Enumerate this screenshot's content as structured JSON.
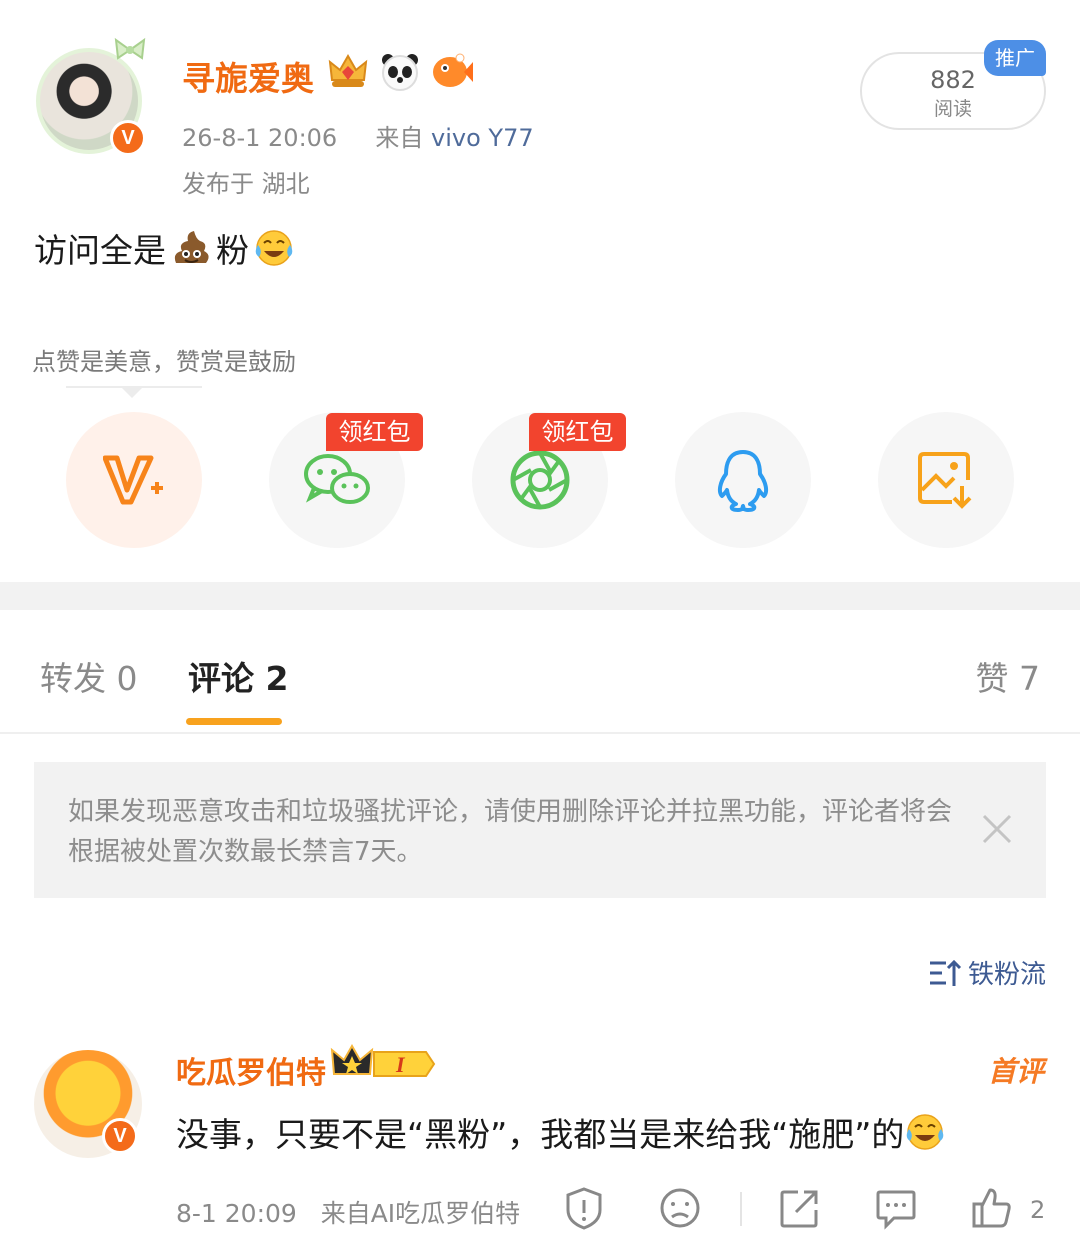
{
  "post": {
    "author": {
      "name": "寻旎爱奥",
      "badges": [
        "crown-gem-badge",
        "panda-badge",
        "orange-fish-badge"
      ],
      "verified": true
    },
    "time": "26-8-1 20:06",
    "source_prefix": "来自",
    "source": "vivo Y77",
    "location": "发布于 湖北",
    "read_count": "882",
    "read_label": "阅读",
    "promo_tag": "推广",
    "content_parts": [
      "访问全是",
      "粉"
    ],
    "content_emojis": [
      "poop-emoji",
      "laugh-cry-emoji"
    ]
  },
  "share": {
    "reward_tip": "点赞是美意，赞赏是鼓励",
    "redpack_label": "领红包",
    "buttons": [
      "vplus-icon",
      "wechat-icon",
      "moments-icon",
      "qq-icon",
      "save-image-icon"
    ]
  },
  "tabs": {
    "forward_label": "转发",
    "forward_count": "0",
    "comment_label": "评论",
    "comment_count": "2",
    "like_label": "赞",
    "like_count": "7"
  },
  "notice": {
    "text": "如果发现恶意攻击和垃圾骚扰评论，请使用删除评论并拉黑功能，评论者将会根据被处置次数最长禁言7天。"
  },
  "sort": {
    "label": "铁粉流"
  },
  "comment": {
    "author": "吃瓜罗伯特",
    "first_badge": "首评",
    "level": "I",
    "text": "没事，只要不是“黑粉”，我都当是来给我“施肥”的",
    "time": "8-1 20:09",
    "source": "来自AI吃瓜罗伯特",
    "like_count": "2"
  },
  "colors": {
    "accent_orange": "#f06a12",
    "tab_indicator": "#f8a21e",
    "link_blue": "#4f6b9a",
    "redpack_red": "#f2442e",
    "promo_blue": "#4d8fe6"
  }
}
